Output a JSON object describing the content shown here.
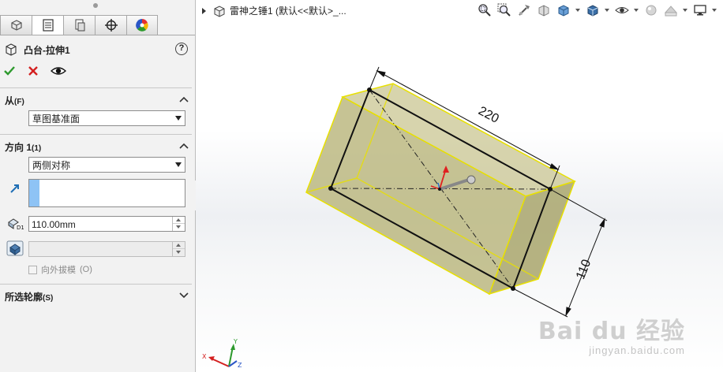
{
  "panel": {
    "tabs": [
      {
        "name": "feature-manager-tab",
        "icon": "feature-tree-icon"
      },
      {
        "name": "property-manager-tab",
        "icon": "property-list-icon"
      },
      {
        "name": "configuration-manager-tab",
        "icon": "configuration-icon"
      },
      {
        "name": "dimxpert-tab",
        "icon": "crosshair-icon"
      },
      {
        "name": "display-manager-tab",
        "icon": "color-wheel-icon"
      }
    ],
    "feature_title": "凸台-拉伸1",
    "help_label": "?",
    "from": {
      "title": "从",
      "shortcut": "(F)",
      "value": "草图基准面"
    },
    "direction1": {
      "title": "方向 1",
      "shortcut": "(1)",
      "end_condition": "两侧对称",
      "depth": "110.00mm",
      "draft_label": "向外拔模",
      "draft_shortcut": "(O)",
      "draft_checked": false
    },
    "contours": {
      "title": "所选轮廓",
      "shortcut": "(S)"
    }
  },
  "viewport": {
    "tree_label": "雷神之锤1  (默认<<默认>_...",
    "dimension_length": "220",
    "dimension_height": "110",
    "triad": {
      "x": "X",
      "y": "Y",
      "z": "Z"
    },
    "watermark_brand": "Bai du 经验",
    "watermark_url": "jingyan.baidu.com"
  },
  "colors": {
    "accent_blue": "#8ec3f5",
    "extrude_fill": "#b7b47c",
    "extrude_edge": "#e8e000",
    "ok_green": "#2e9a2e",
    "cancel_red": "#d42020"
  }
}
